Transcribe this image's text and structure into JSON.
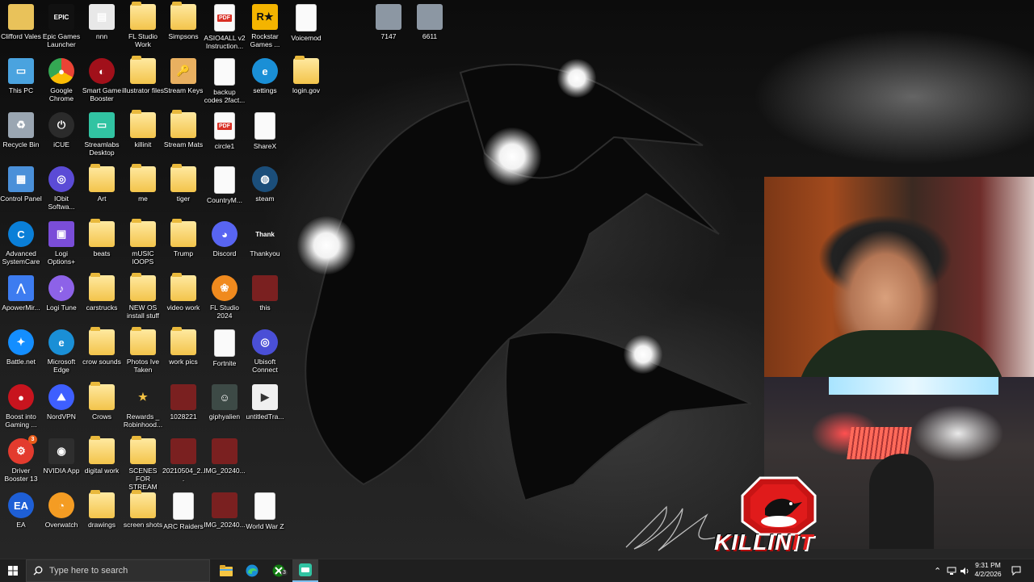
{
  "desktop": {
    "columns": [
      [
        {
          "label": "Clifford Vales",
          "icon": "user-folder-icon"
        },
        {
          "label": "This PC",
          "icon": "computer-icon"
        },
        {
          "label": "Recycle Bin",
          "icon": "recycle-bin-icon"
        },
        {
          "label": "Control Panel",
          "icon": "control-panel-icon"
        },
        {
          "label": "Advanced SystemCare",
          "icon": "advanced-systemcare-icon"
        },
        {
          "label": "ApowerMir...",
          "icon": "apowermirror-icon"
        },
        {
          "label": "Battle.net",
          "icon": "battlenet-icon"
        },
        {
          "label": "Boost into Gaming ...",
          "icon": "boost-gaming-icon"
        },
        {
          "label": "Driver Booster 13",
          "icon": "driver-booster-icon"
        },
        {
          "label": "EA",
          "icon": "ea-icon"
        }
      ],
      [
        {
          "label": "Epic Games Launcher",
          "icon": "epic-games-icon"
        },
        {
          "label": "Google Chrome",
          "icon": "chrome-icon"
        },
        {
          "label": "iCUE",
          "icon": "icue-icon"
        },
        {
          "label": "IObit Softwa...",
          "icon": "iobit-icon"
        },
        {
          "label": "Logi Options+",
          "icon": "logi-options-icon"
        },
        {
          "label": "Logi Tune",
          "icon": "logi-tune-icon"
        },
        {
          "label": "Microsoft Edge",
          "icon": "edge-icon"
        },
        {
          "label": "NordVPN",
          "icon": "nordvpn-icon"
        },
        {
          "label": "NVIDIA App",
          "icon": "nvidia-icon"
        },
        {
          "label": "Overwatch",
          "icon": "overwatch-icon"
        }
      ],
      [
        {
          "label": "nnn",
          "icon": "app-window-icon"
        },
        {
          "label": "Smart Game Booster",
          "icon": "smart-game-booster-icon"
        },
        {
          "label": "Streamlabs Desktop",
          "icon": "streamlabs-icon"
        },
        {
          "label": "Art",
          "icon": "folder-icon"
        },
        {
          "label": "beats",
          "icon": "folder-icon"
        },
        {
          "label": "carstrucks",
          "icon": "folder-icon"
        },
        {
          "label": "crow sounds",
          "icon": "folder-icon"
        },
        {
          "label": "Crows",
          "icon": "folder-icon"
        },
        {
          "label": "digital work",
          "icon": "folder-icon"
        },
        {
          "label": "drawings",
          "icon": "folder-icon"
        }
      ],
      [
        {
          "label": "FL Studio Work",
          "icon": "folder-icon"
        },
        {
          "label": "illustrator files",
          "icon": "folder-icon"
        },
        {
          "label": "killinit",
          "icon": "folder-icon"
        },
        {
          "label": "me",
          "icon": "folder-icon"
        },
        {
          "label": "mUSIC lOOPS",
          "icon": "folder-icon"
        },
        {
          "label": "NEW OS install stuff",
          "icon": "folder-icon"
        },
        {
          "label": "Photos Ive Taken",
          "icon": "folder-icon"
        },
        {
          "label": "Rewards _ Robinhood...",
          "icon": "star-icon"
        },
        {
          "label": "SCENES FOR STREAM",
          "icon": "folder-icon"
        },
        {
          "label": "screen shots",
          "icon": "folder-icon"
        }
      ],
      [
        {
          "label": "Simpsons",
          "icon": "folder-icon"
        },
        {
          "label": "Stream Keys",
          "icon": "key-icon"
        },
        {
          "label": "Stream Mats",
          "icon": "folder-icon"
        },
        {
          "label": "tiger",
          "icon": "folder-icon"
        },
        {
          "label": "Trump",
          "icon": "folder-icon"
        },
        {
          "label": "video work",
          "icon": "folder-icon"
        },
        {
          "label": "work pics",
          "icon": "folder-icon"
        },
        {
          "label": "1028221",
          "icon": "image-file-icon"
        },
        {
          "label": "20210504_2...",
          "icon": "image-file-icon"
        },
        {
          "label": "ARC Raiders",
          "icon": "document-icon"
        }
      ],
      [
        {
          "label": "ASIO4ALL v2 Instruction...",
          "icon": "pdf-icon"
        },
        {
          "label": "backup codes 2fact...",
          "icon": "document-icon"
        },
        {
          "label": "circle1",
          "icon": "pdf-icon"
        },
        {
          "label": "CountryM...",
          "icon": "document-icon"
        },
        {
          "label": "Discord",
          "icon": "discord-icon"
        },
        {
          "label": "FL Studio 2024",
          "icon": "fl-studio-icon"
        },
        {
          "label": "Fortnite",
          "icon": "document-icon"
        },
        {
          "label": "giphyalien",
          "icon": "alien-image-icon"
        },
        {
          "label": "IMG_20240...",
          "icon": "image-file-icon"
        },
        {
          "label": "IMG_20240...",
          "icon": "image-file-icon"
        }
      ],
      [
        {
          "label": "Rockstar Games ...",
          "icon": "rockstar-icon"
        },
        {
          "label": "settings",
          "icon": "edge-icon"
        },
        {
          "label": "ShareX",
          "icon": "document-icon"
        },
        {
          "label": "steam",
          "icon": "steam-icon"
        },
        {
          "label": "Thankyou",
          "icon": "thank-you-image-icon"
        },
        {
          "label": "this",
          "icon": "image-file-icon"
        },
        {
          "label": "Ubisoft Connect",
          "icon": "ubisoft-icon"
        },
        {
          "label": "untitledTra...",
          "icon": "video-file-icon"
        },
        {
          "label": "",
          "icon": ""
        },
        {
          "label": "World War Z",
          "icon": "document-icon"
        }
      ],
      [
        {
          "label": "Voicemod",
          "icon": "document-icon"
        },
        {
          "label": "login.gov",
          "icon": "folder-icon"
        }
      ]
    ],
    "extra": [
      {
        "label": "7147",
        "icon": "photo-thumbnail-icon"
      },
      {
        "label": "6611",
        "icon": "photo-thumbnail-icon"
      }
    ]
  },
  "overlay": {
    "brand": "KILLIN",
    "brand_highlight": "IT"
  },
  "taskbar": {
    "search_placeholder": "Type here to search",
    "xbox_badge": "3",
    "clock_time": "9:31 PM",
    "clock_date": "4/2/2026"
  },
  "badges": {
    "driver_booster": "3"
  },
  "colors": {
    "taskbar_bg": "#1f1f1f",
    "accent": "#7fc0f0",
    "brand_red": "#e01b1b"
  }
}
